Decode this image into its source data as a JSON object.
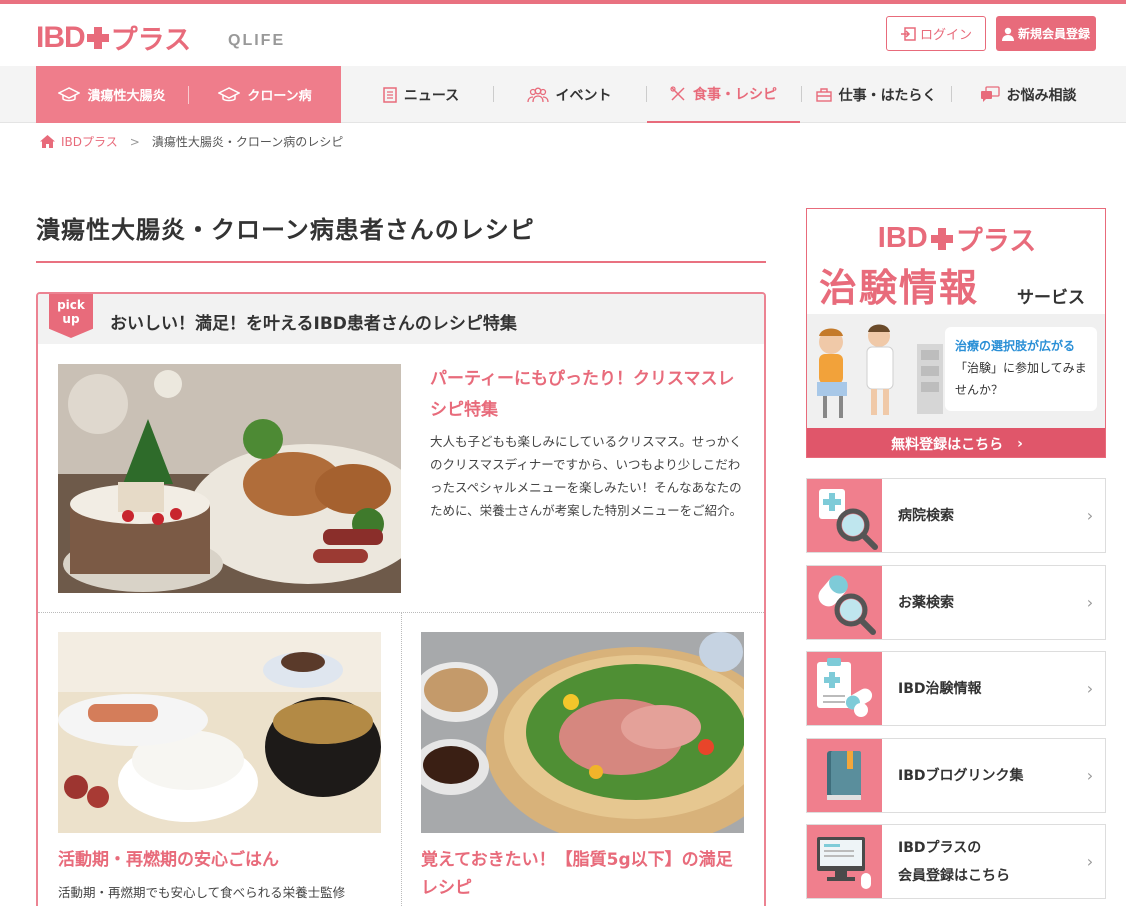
{
  "header": {
    "logo_text": "IBD",
    "logo_suffix": "プラス",
    "partner": "QLIFE",
    "login_label": "ログイン",
    "signup_label": "新規会員登録"
  },
  "nav": {
    "uc": "潰瘍性大腸炎",
    "crohn": "クローン病",
    "news": "ニュース",
    "event": "イベント",
    "recipe": "食事・レシピ",
    "work": "仕事・はたらく",
    "consult": "お悩み相談"
  },
  "breadcrumb": {
    "home": "IBDプラス",
    "separator": ">",
    "current": "潰瘍性大腸炎・クローン病のレシピ"
  },
  "page_title": "潰瘍性大腸炎・クローン病患者さんのレシピ",
  "pickup": {
    "badge_line1": "pick",
    "badge_line2": "up",
    "title": "おいしい！満足！を叶えるIBD患者さんのレシピ特集",
    "featured": {
      "title": "パーティーにもぴったり！クリスマスレシピ特集",
      "desc": "大人も子どもも楽しみにしているクリスマス。せっかくのクリスマスディナーですから、いつもより少しこだわったスペシャルメニューを楽しみたい！そんなあなたのために、栄養士さんが考案した特別メニューをご紹介。"
    },
    "items": [
      {
        "title": "活動期・再燃期の安心ごはん",
        "desc": "活動期・再燃期でも安心して食べられる栄養士監修"
      },
      {
        "title": "覚えておきたい！【脂質5g以下】の満足レシピ",
        "desc": ""
      }
    ]
  },
  "banner": {
    "logo_text": "IBD",
    "logo_suffix": "プラス",
    "main": "治験情報",
    "sub": "サービス",
    "bubble_line1": "治療の選択肢が広がる",
    "bubble_line2": "「治験」に参加してみませんか？",
    "cta": "無料登録はこちら",
    "cta_arrow": "›"
  },
  "side_links": [
    {
      "label": "病院検索",
      "icon": "hospital-search-icon"
    },
    {
      "label": "お薬検索",
      "icon": "medicine-search-icon"
    },
    {
      "label": "IBD治験情報",
      "icon": "clinical-trial-icon"
    },
    {
      "label": "IBDブログリンク集",
      "icon": "blog-book-icon"
    },
    {
      "label": "IBDプラスの会員登録はこちら",
      "label_line1": "IBDプラスの",
      "label_line2": "会員登録はこちら",
      "icon": "computer-icon"
    }
  ],
  "chevron": "›",
  "colors": {
    "accent": "#e86b7b",
    "nav_pink": "#ef7d8b",
    "tile": "#f07f8d",
    "cta": "#e0566a",
    "blue": "#2a8fd6"
  }
}
